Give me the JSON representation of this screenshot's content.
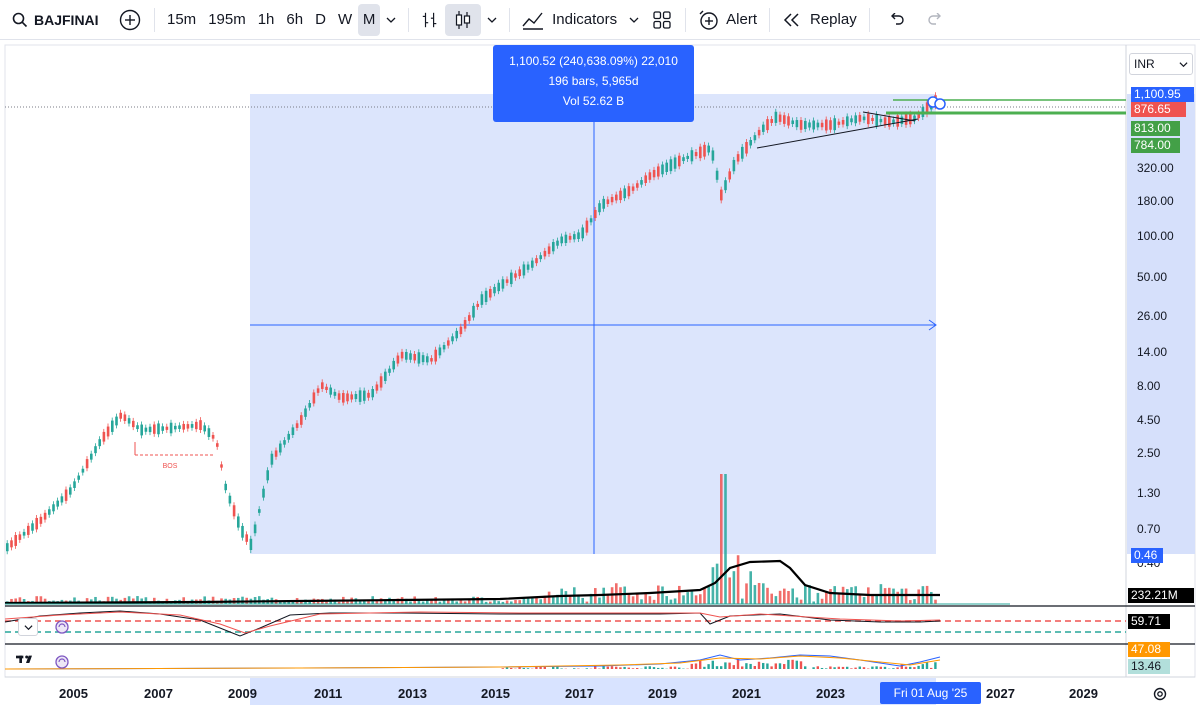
{
  "toolbar": {
    "symbol": "BAJFINAI",
    "intervals": [
      "15m",
      "195m",
      "1h",
      "6h",
      "D",
      "W",
      "M"
    ],
    "active_interval": "M",
    "indicators_label": "Indicators",
    "alert_label": "Alert",
    "replay_label": "Replay"
  },
  "currency": "INR",
  "measure_tooltip": {
    "line1": "1,100.52 (240,638.09%) 22,010",
    "line2": "196 bars, 5,965d",
    "line3": "Vol 52.62 B"
  },
  "price_axis_labels": [
    "320.00",
    "180.00",
    "100.00",
    "50.00",
    "26.00",
    "14.00",
    "8.00",
    "4.50",
    "2.50",
    "1.30",
    "0.70",
    "0.40"
  ],
  "price_tags": {
    "current": "1,100.95",
    "red": "876.65",
    "green1": "813.00",
    "green2": "784.00",
    "low": "0.46",
    "volume": "232.21M",
    "rsi": "59.71",
    "macd1": "47.08",
    "macd2": "13.46"
  },
  "annotation": "BOS",
  "time_axis": [
    "2005",
    "2007",
    "2009",
    "2011",
    "2013",
    "2015",
    "2017",
    "2019",
    "2021",
    "2023",
    "2027",
    "2029"
  ],
  "crosshair_date": "Fri 01 Aug '25",
  "colors": {
    "up": "#26a69a",
    "down": "#ef5350",
    "accent": "#2962ff",
    "range_fill": "#d6e0fb"
  }
}
